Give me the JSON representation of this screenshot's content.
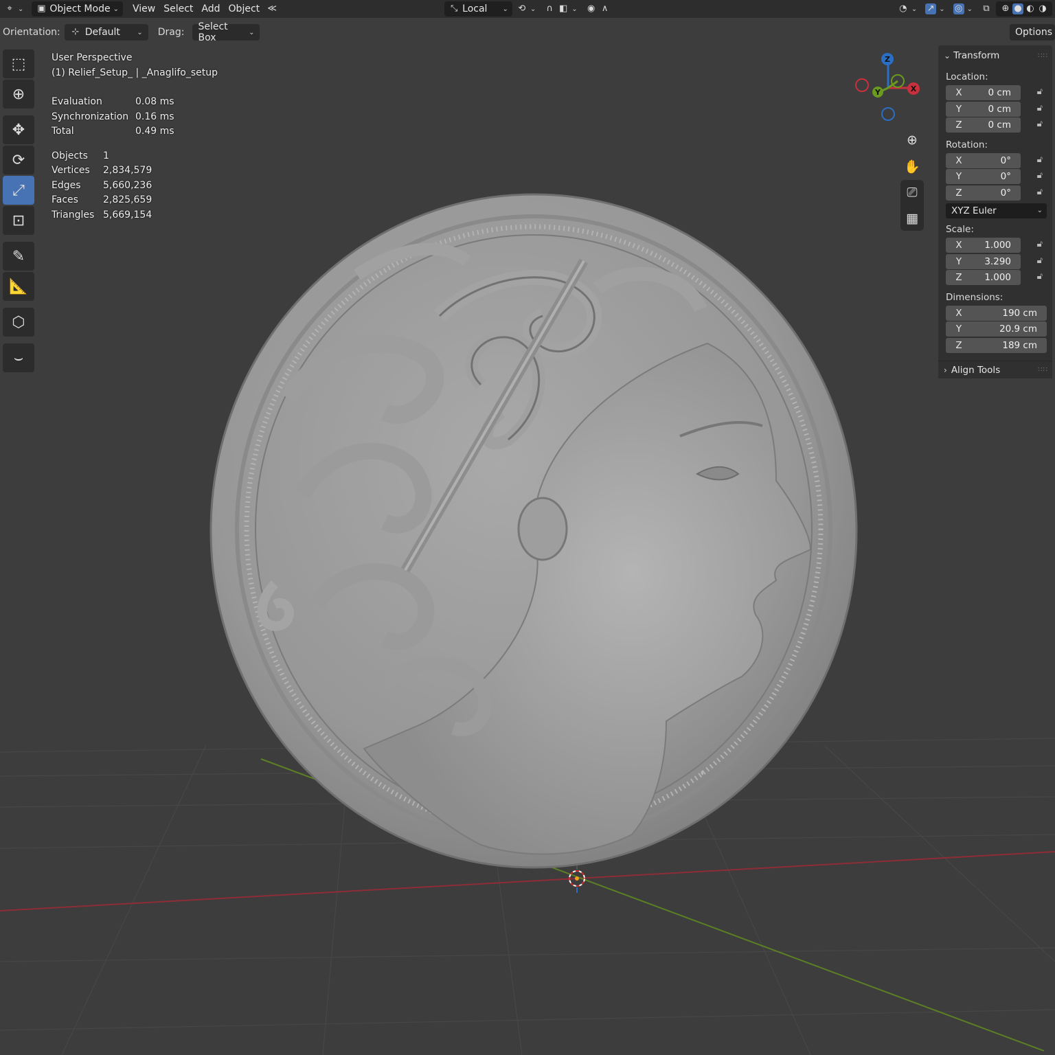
{
  "header": {
    "editor_icon": "3d-viewport-icon",
    "mode": "Object Mode",
    "menus": [
      "View",
      "Select",
      "Add",
      "Object"
    ],
    "pivot": "Local"
  },
  "tool_settings": {
    "orientation_label": "Orientation:",
    "orientation_value": "Default",
    "drag_label": "Drag:",
    "drag_value": "Select Box",
    "options": "Options"
  },
  "overlay": {
    "view_name": "User Perspective",
    "object_name": "(1) Relief_Setup_ | _Anaglifo_setup",
    "timings": [
      {
        "label": "Evaluation",
        "value": "0.08 ms"
      },
      {
        "label": "Synchronization",
        "value": "0.16 ms"
      },
      {
        "label": "Total",
        "value": "0.49 ms"
      }
    ],
    "stats": [
      {
        "label": "Objects",
        "value": "1"
      },
      {
        "label": "Vertices",
        "value": "2,834,579"
      },
      {
        "label": "Edges",
        "value": "5,660,236"
      },
      {
        "label": "Faces",
        "value": "2,825,659"
      },
      {
        "label": "Triangles",
        "value": "5,669,154"
      }
    ]
  },
  "gizmo": {
    "z": "Z",
    "y": "Y",
    "x": "X"
  },
  "sidebar": {
    "transform_title": "Transform",
    "location_label": "Location:",
    "location": [
      {
        "axis": "X",
        "value": "0 cm"
      },
      {
        "axis": "Y",
        "value": "0 cm"
      },
      {
        "axis": "Z",
        "value": "0 cm"
      }
    ],
    "rotation_label": "Rotation:",
    "rotation": [
      {
        "axis": "X",
        "value": "0°"
      },
      {
        "axis": "Y",
        "value": "0°"
      },
      {
        "axis": "Z",
        "value": "0°"
      }
    ],
    "rotation_mode": "XYZ Euler",
    "scale_label": "Scale:",
    "scale": [
      {
        "axis": "X",
        "value": "1.000"
      },
      {
        "axis": "Y",
        "value": "3.290"
      },
      {
        "axis": "Z",
        "value": "1.000"
      }
    ],
    "dimensions_label": "Dimensions:",
    "dimensions": [
      {
        "axis": "X",
        "value": "190 cm"
      },
      {
        "axis": "Y",
        "value": "20.9 cm"
      },
      {
        "axis": "Z",
        "value": "189 cm"
      }
    ],
    "align_tools": "Align Tools"
  },
  "colors": {
    "x_axis": "#c9303e",
    "y_axis": "#6a9a1f",
    "z_axis": "#2a6fc4",
    "active_tool": "#4772b3",
    "viewport_bg": "#3d3d3d"
  }
}
